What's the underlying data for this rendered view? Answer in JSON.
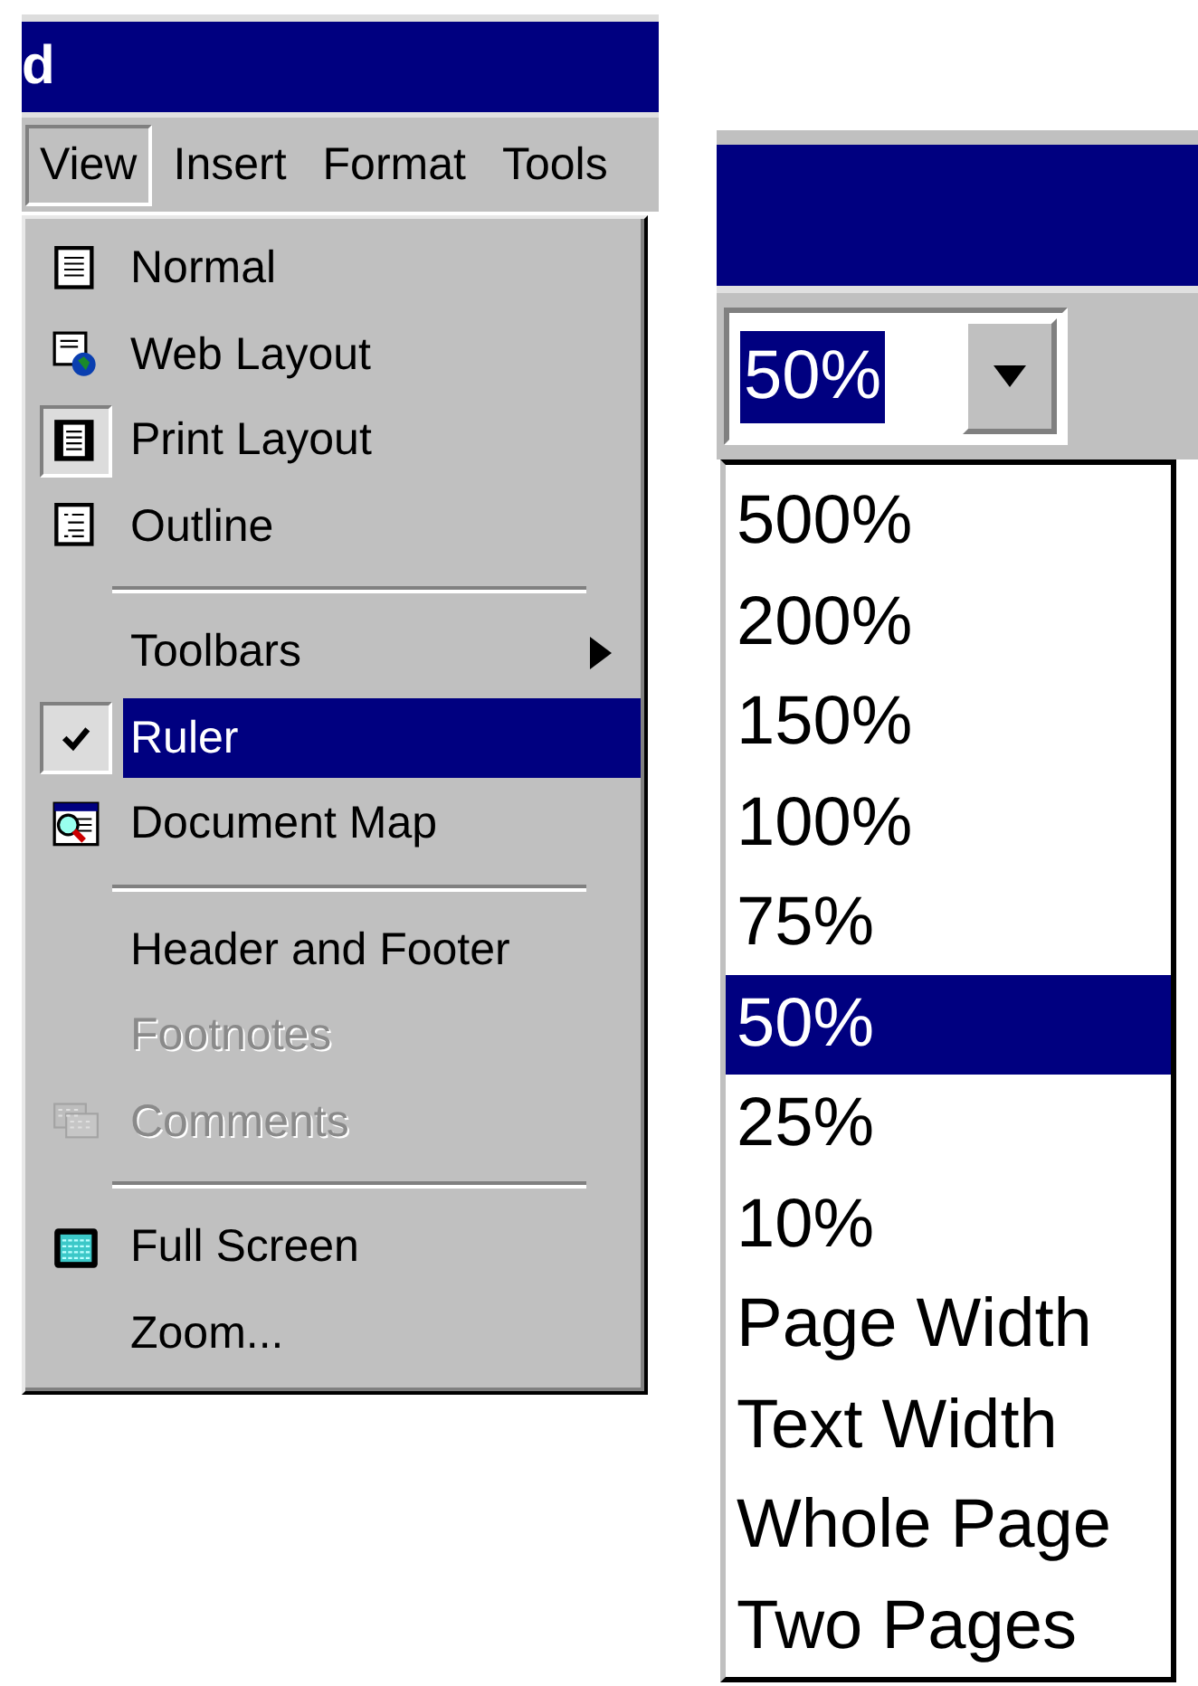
{
  "word_window": {
    "title": "d",
    "menu_bar": [
      {
        "label": "View",
        "selected": true
      },
      {
        "label": "Insert",
        "selected": false
      },
      {
        "label": "Format",
        "selected": false
      },
      {
        "label": "Tools",
        "selected": false
      }
    ],
    "view_menu": [
      {
        "kind": "item",
        "label": "Normal",
        "checked": false,
        "disabled": false,
        "selected": false
      },
      {
        "kind": "item",
        "label": "Web Layout",
        "checked": false,
        "disabled": false,
        "selected": false
      },
      {
        "kind": "item",
        "label": "Print Layout",
        "checked": true,
        "disabled": false,
        "selected": false
      },
      {
        "kind": "item",
        "label": "Outline",
        "checked": false,
        "disabled": false,
        "selected": false
      },
      {
        "kind": "separator"
      },
      {
        "kind": "submenu",
        "label": "Toolbars",
        "checked": false,
        "disabled": false,
        "selected": false
      },
      {
        "kind": "item",
        "label": "Ruler",
        "checked": true,
        "disabled": false,
        "selected": true
      },
      {
        "kind": "item",
        "label": "Document Map",
        "checked": false,
        "disabled": false,
        "selected": false
      },
      {
        "kind": "separator"
      },
      {
        "kind": "item",
        "label": "Header and Footer",
        "checked": false,
        "disabled": false,
        "selected": false
      },
      {
        "kind": "item",
        "label": "Footnotes",
        "checked": false,
        "disabled": true,
        "selected": false
      },
      {
        "kind": "item",
        "label": "Comments",
        "checked": false,
        "disabled": true,
        "selected": false
      },
      {
        "kind": "separator"
      },
      {
        "kind": "item",
        "label": "Full Screen",
        "checked": false,
        "disabled": false,
        "selected": false
      },
      {
        "kind": "item",
        "label": "Zoom...",
        "checked": false,
        "disabled": false,
        "selected": false
      }
    ]
  },
  "zoom_window": {
    "zoom_box": {
      "value": "50%"
    },
    "zoom_options": [
      {
        "label": "500%",
        "selected": false
      },
      {
        "label": "200%",
        "selected": false
      },
      {
        "label": "150%",
        "selected": false
      },
      {
        "label": "100%",
        "selected": false
      },
      {
        "label": "75%",
        "selected": false
      },
      {
        "label": "50%",
        "selected": true
      },
      {
        "label": "25%",
        "selected": false
      },
      {
        "label": "10%",
        "selected": false
      },
      {
        "label": "Page Width",
        "selected": false
      },
      {
        "label": "Text Width",
        "selected": false
      },
      {
        "label": "Whole Page",
        "selected": false
      },
      {
        "label": "Two Pages",
        "selected": false
      }
    ]
  }
}
